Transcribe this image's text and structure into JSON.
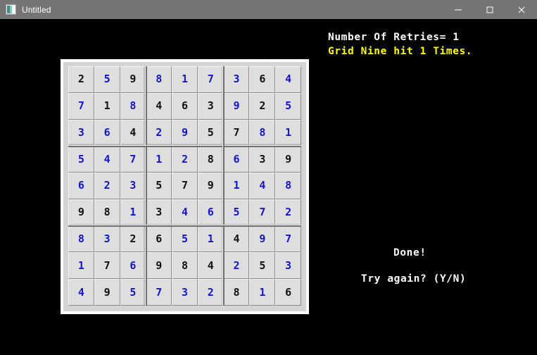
{
  "window": {
    "title": "Untitled",
    "icon": "app-window-icon",
    "controls": [
      {
        "name": "minimize-button",
        "glyph": "minimize-icon"
      },
      {
        "name": "maximize-button",
        "glyph": "maximize-icon"
      },
      {
        "name": "close-button",
        "glyph": "close-icon"
      }
    ],
    "titlebar_color": "#757575",
    "client_color": "#000000"
  },
  "console": {
    "retries_label": "Number Of Retries= 1",
    "retries_color": "#ffffff",
    "grid_hit_label": "Grid Nine hit 1 Times.",
    "grid_hit_color": "#ffff00",
    "done_label": "Done!",
    "try_again_label": "Try again? (Y/N)"
  },
  "board": {
    "frame_color": "#ffffff",
    "panel_color": "#d4d4d4",
    "cell_color": "#dedede",
    "given_color": "#111111",
    "filled_color": "#1414c8",
    "rows": 9,
    "cols": 9,
    "cells": [
      [
        {
          "value": "2",
          "style": "given"
        },
        {
          "value": "5",
          "style": "filled"
        },
        {
          "value": "9",
          "style": "given"
        },
        {
          "value": "8",
          "style": "filled"
        },
        {
          "value": "1",
          "style": "filled"
        },
        {
          "value": "7",
          "style": "filled"
        },
        {
          "value": "3",
          "style": "filled"
        },
        {
          "value": "6",
          "style": "given"
        },
        {
          "value": "4",
          "style": "filled"
        }
      ],
      [
        {
          "value": "7",
          "style": "filled"
        },
        {
          "value": "1",
          "style": "given"
        },
        {
          "value": "8",
          "style": "filled"
        },
        {
          "value": "4",
          "style": "given"
        },
        {
          "value": "6",
          "style": "given"
        },
        {
          "value": "3",
          "style": "given"
        },
        {
          "value": "9",
          "style": "filled"
        },
        {
          "value": "2",
          "style": "given"
        },
        {
          "value": "5",
          "style": "filled"
        }
      ],
      [
        {
          "value": "3",
          "style": "filled"
        },
        {
          "value": "6",
          "style": "filled"
        },
        {
          "value": "4",
          "style": "given"
        },
        {
          "value": "2",
          "style": "filled"
        },
        {
          "value": "9",
          "style": "filled"
        },
        {
          "value": "5",
          "style": "given"
        },
        {
          "value": "7",
          "style": "given"
        },
        {
          "value": "8",
          "style": "filled"
        },
        {
          "value": "1",
          "style": "filled"
        }
      ],
      [
        {
          "value": "5",
          "style": "filled"
        },
        {
          "value": "4",
          "style": "filled"
        },
        {
          "value": "7",
          "style": "filled"
        },
        {
          "value": "1",
          "style": "filled"
        },
        {
          "value": "2",
          "style": "filled"
        },
        {
          "value": "8",
          "style": "given"
        },
        {
          "value": "6",
          "style": "filled"
        },
        {
          "value": "3",
          "style": "given"
        },
        {
          "value": "9",
          "style": "given"
        }
      ],
      [
        {
          "value": "6",
          "style": "filled"
        },
        {
          "value": "2",
          "style": "filled"
        },
        {
          "value": "3",
          "style": "filled"
        },
        {
          "value": "5",
          "style": "given"
        },
        {
          "value": "7",
          "style": "given"
        },
        {
          "value": "9",
          "style": "given"
        },
        {
          "value": "1",
          "style": "filled"
        },
        {
          "value": "4",
          "style": "filled"
        },
        {
          "value": "8",
          "style": "filled"
        }
      ],
      [
        {
          "value": "9",
          "style": "given"
        },
        {
          "value": "8",
          "style": "given"
        },
        {
          "value": "1",
          "style": "filled"
        },
        {
          "value": "3",
          "style": "given"
        },
        {
          "value": "4",
          "style": "filled"
        },
        {
          "value": "6",
          "style": "filled"
        },
        {
          "value": "5",
          "style": "filled"
        },
        {
          "value": "7",
          "style": "filled"
        },
        {
          "value": "2",
          "style": "filled"
        }
      ],
      [
        {
          "value": "8",
          "style": "filled"
        },
        {
          "value": "3",
          "style": "filled"
        },
        {
          "value": "2",
          "style": "given"
        },
        {
          "value": "6",
          "style": "given"
        },
        {
          "value": "5",
          "style": "filled"
        },
        {
          "value": "1",
          "style": "filled"
        },
        {
          "value": "4",
          "style": "given"
        },
        {
          "value": "9",
          "style": "filled"
        },
        {
          "value": "7",
          "style": "filled"
        }
      ],
      [
        {
          "value": "1",
          "style": "filled"
        },
        {
          "value": "7",
          "style": "given"
        },
        {
          "value": "6",
          "style": "filled"
        },
        {
          "value": "9",
          "style": "given"
        },
        {
          "value": "8",
          "style": "given"
        },
        {
          "value": "4",
          "style": "given"
        },
        {
          "value": "2",
          "style": "filled"
        },
        {
          "value": "5",
          "style": "given"
        },
        {
          "value": "3",
          "style": "filled"
        }
      ],
      [
        {
          "value": "4",
          "style": "filled"
        },
        {
          "value": "9",
          "style": "given"
        },
        {
          "value": "5",
          "style": "filled"
        },
        {
          "value": "7",
          "style": "filled"
        },
        {
          "value": "3",
          "style": "filled"
        },
        {
          "value": "2",
          "style": "filled"
        },
        {
          "value": "8",
          "style": "given"
        },
        {
          "value": "1",
          "style": "filled"
        },
        {
          "value": "6",
          "style": "given"
        }
      ]
    ]
  }
}
